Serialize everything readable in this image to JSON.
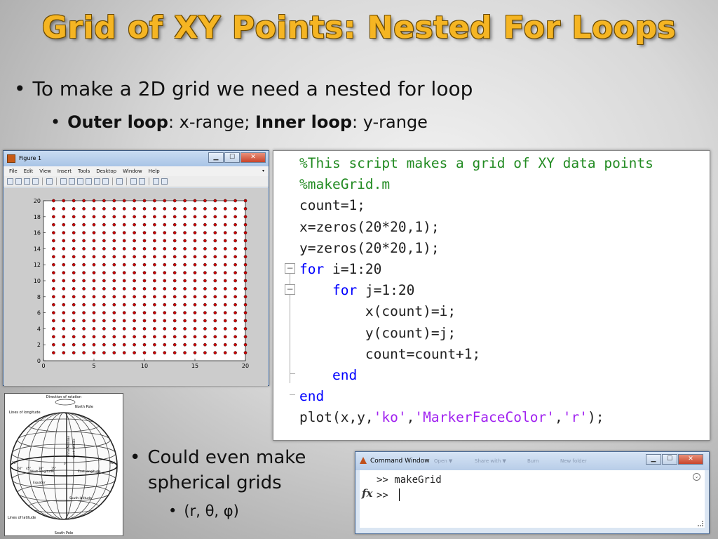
{
  "slide": {
    "title": "Grid of XY Points: Nested For Loops",
    "bullet1": "To make a 2D grid we need a nested for loop",
    "bullet2": {
      "outer_bold": "Outer loop",
      "outer_rest": ": x-range; ",
      "inner_bold": "Inner loop",
      "inner_rest": ": y-range"
    },
    "bullet3_line1": "Could even make",
    "bullet3_line2": "spherical grids",
    "bullet4": "(r, θ, φ)",
    "bullet_symbol": "•"
  },
  "figure_window": {
    "title": "Figure 1",
    "menu": [
      "File",
      "Edit",
      "View",
      "Insert",
      "Tools",
      "Desktop",
      "Window",
      "Help"
    ],
    "window_buttons": {
      "minimize": "▁",
      "maximize": "☐",
      "close": "✕"
    },
    "toolbar_icons": [
      "new-figure-icon",
      "open-icon",
      "save-icon",
      "print-icon",
      "pointer-icon",
      "zoom-in-icon",
      "zoom-out-icon",
      "pan-icon",
      "rotate-icon",
      "data-cursor-icon",
      "brush-icon",
      "link-icon",
      "colorbar-icon",
      "legend-icon",
      "hide-tools-icon",
      "show-tools-icon"
    ],
    "marker_face_color": "#cc0000"
  },
  "chart_data": {
    "type": "scatter",
    "description_of_grid": "points at every integer x in 1..20 and y in 1..20",
    "x_values": [
      1,
      2,
      3,
      4,
      5,
      6,
      7,
      8,
      9,
      10,
      11,
      12,
      13,
      14,
      15,
      16,
      17,
      18,
      19,
      20
    ],
    "y_values": [
      1,
      2,
      3,
      4,
      5,
      6,
      7,
      8,
      9,
      10,
      11,
      12,
      13,
      14,
      15,
      16,
      17,
      18,
      19,
      20
    ],
    "xlim": [
      0,
      20
    ],
    "ylim": [
      0,
      20
    ],
    "xticks": [
      "0",
      "5",
      "10",
      "15",
      "20"
    ],
    "yticks": [
      "0",
      "2",
      "4",
      "6",
      "8",
      "10",
      "12",
      "14",
      "16",
      "18",
      "20"
    ],
    "marker_color": "#cc0000",
    "title": "",
    "xlabel": "",
    "ylabel": ""
  },
  "code": {
    "lines": [
      {
        "parts": [
          {
            "t": "%This script makes a grid of XY data points",
            "c": "comment"
          }
        ]
      },
      {
        "parts": [
          {
            "t": "%makeGrid.m",
            "c": "comment"
          }
        ]
      },
      {
        "parts": [
          {
            "t": "count=1;",
            "c": "plain"
          }
        ]
      },
      {
        "parts": [
          {
            "t": "x=zeros(20*20,1);",
            "c": "plain"
          }
        ]
      },
      {
        "parts": [
          {
            "t": "y=zeros(20*20,1);",
            "c": "plain"
          }
        ]
      },
      {
        "parts": [
          {
            "t": "for",
            "c": "kw"
          },
          {
            "t": " i=1:20",
            "c": "plain"
          }
        ]
      },
      {
        "parts": [
          {
            "t": "    ",
            "c": "plain"
          },
          {
            "t": "for",
            "c": "kw"
          },
          {
            "t": " j=1:20",
            "c": "plain"
          }
        ]
      },
      {
        "parts": [
          {
            "t": "        x(count)=i;",
            "c": "plain"
          }
        ]
      },
      {
        "parts": [
          {
            "t": "        y(count)=j;",
            "c": "plain"
          }
        ]
      },
      {
        "parts": [
          {
            "t": "        count=count+1;",
            "c": "plain"
          }
        ]
      },
      {
        "parts": [
          {
            "t": "    ",
            "c": "plain"
          },
          {
            "t": "end",
            "c": "kw"
          }
        ]
      },
      {
        "parts": [
          {
            "t": "end",
            "c": "kw"
          }
        ]
      },
      {
        "parts": [
          {
            "t": "plot(x,y,",
            "c": "plain"
          },
          {
            "t": "'ko'",
            "c": "str"
          },
          {
            "t": ",",
            "c": "plain"
          },
          {
            "t": "'MarkerFaceColor'",
            "c": "str"
          },
          {
            "t": ",",
            "c": "plain"
          },
          {
            "t": "'r'",
            "c": "str"
          },
          {
            "t": ");",
            "c": "plain"
          }
        ]
      }
    ],
    "fold_marker": "−"
  },
  "globe": {
    "labels": {
      "top": "Direction of rotation",
      "north_pole": "North Pole",
      "south_pole": "South Pole",
      "lines_longitude": "Lines of longitude",
      "lines_latitude": "Lines of latitude",
      "equator": "Equator",
      "west_longitude": "West longitude",
      "east_longitude": "East longitude",
      "south_latitude": "South latitude",
      "prime_meridian": "Prime Meridian",
      "north_latitude": "North latitude"
    },
    "degree_labels": [
      "0°",
      "15°",
      "30°",
      "45°",
      "60°",
      "75°",
      "90°"
    ]
  },
  "command_window": {
    "title": "Command Window",
    "line1": ">> makeGrid",
    "line2": ">> ",
    "fx_label": "fx",
    "scroll_icon": "⌄",
    "ghost_menu": [
      "Open ▼",
      "Share with ▼",
      "Burn",
      "New folder"
    ]
  }
}
